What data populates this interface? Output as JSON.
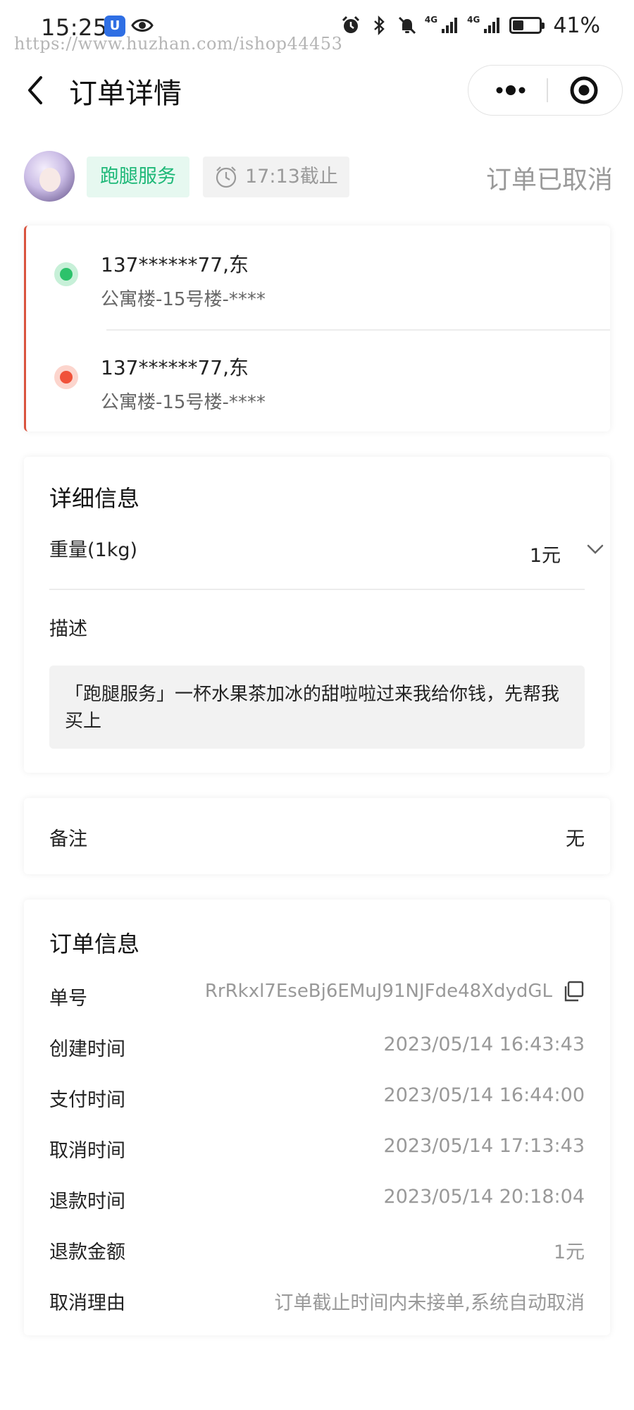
{
  "status_bar": {
    "time": "15:25",
    "app_badge": "U",
    "watermark": "https://www.huzhan.com/ishop44453",
    "network_1": "4G",
    "network_2": "4G",
    "battery_percent": "41%",
    "battery_level": 0.41,
    "icons": [
      "shield-app-icon",
      "eye-icon",
      "alarm-icon",
      "bluetooth-icon",
      "mute-icon",
      "signal-icon",
      "signal-icon",
      "battery-icon"
    ]
  },
  "nav": {
    "title": "订单详情",
    "back_icon": "chevron-left-icon",
    "more_icon": "more-dots-icon",
    "close_icon": "target-circle-icon"
  },
  "header": {
    "service_tag": "跑腿服务",
    "deadline": "17:13截止",
    "status": "订单已取消"
  },
  "addresses": [
    {
      "phone_name": "137******77,东",
      "detail": "公寓楼-15号楼-****",
      "type": "pickup",
      "color": "#2dc26b"
    },
    {
      "phone_name": "137******77,东",
      "detail": "公寓楼-15号楼-****",
      "type": "delivery",
      "color": "#f0523a"
    }
  ],
  "detail": {
    "title": "详细信息",
    "weight_label": "重量(1kg)",
    "weight_value": "1元",
    "desc_label": "描述",
    "desc_text": "「跑腿服务」一杯水果茶加冰的甜啦啦过来我给你钱，先帮我买上"
  },
  "remark": {
    "label": "备注",
    "value": "无"
  },
  "order_info": {
    "title": "订单信息",
    "rows": [
      {
        "label": "单号",
        "value": "RrRkxl7EseBj6EMuJ91NJFde48XdydGL"
      },
      {
        "label": "创建时间",
        "value": "2023/05/14 16:43:43"
      },
      {
        "label": "支付时间",
        "value": "2023/05/14 16:44:00"
      },
      {
        "label": "取消时间",
        "value": "2023/05/14 17:13:43"
      },
      {
        "label": "退款时间",
        "value": "2023/05/14 20:18:04"
      },
      {
        "label": "退款金额",
        "value": "1元"
      },
      {
        "label": "取消理由",
        "value": "订单截止时间内未接单,系统自动取消"
      }
    ]
  },
  "colors": {
    "accent_green": "#1eb878",
    "cancel_red": "#d9533e",
    "muted_gray": "#9a9a9a"
  }
}
